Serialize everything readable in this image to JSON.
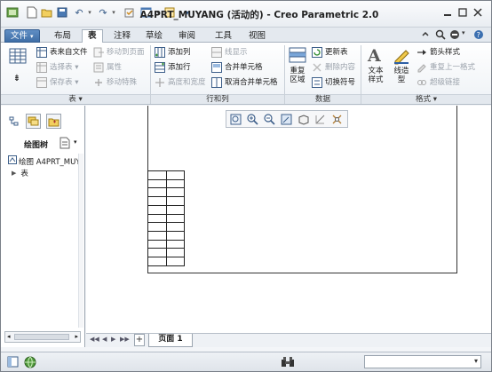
{
  "window": {
    "title": "A4PRT_MUYANG (活动的) - Creo Parametric 2.0"
  },
  "ribbon_tabs": [
    {
      "label": "文件",
      "arrow": "▾"
    },
    {
      "label": "布局"
    },
    {
      "label": "表"
    },
    {
      "label": "注释"
    },
    {
      "label": "草绘"
    },
    {
      "label": "审阅"
    },
    {
      "label": "工具"
    },
    {
      "label": "视图"
    }
  ],
  "ribbon": {
    "table_group": {
      "label": "表 ▾",
      "from_file": "表来自文件",
      "select_table": "选择表 ▾",
      "save_table": "保存表 ▾"
    },
    "move_group": {
      "move_to_page": "移动到页面",
      "properties": "属性",
      "move_special": "移动特殊"
    },
    "rows_cols_group": {
      "label": "行和列",
      "add_column": "添加列",
      "add_row": "添加行",
      "height_width": "高度和宽度",
      "line_display": "线显示",
      "merge_cells": "合并单元格",
      "unmerge_cells": "取消合并单元格"
    },
    "data_group": {
      "label": "数据",
      "repeat_region": "重复\n区域",
      "update_table": "更新表",
      "delete_content": "删除内容",
      "switch_symbols": "切换符号"
    },
    "format_group": {
      "label": "格式 ▾",
      "text_style": "文本\n样式",
      "line_style": "线造\n型",
      "arrow_style": "箭头样式",
      "repeat_format": "重复上一格式",
      "hyperlink": "超级链接"
    }
  },
  "left_panel": {
    "header": "绘图树",
    "tree": [
      {
        "label": "绘图 A4PRT_MUY"
      },
      {
        "label": "表"
      }
    ]
  },
  "page_tabs": {
    "add": "+",
    "current": "页面 1"
  },
  "colors": {
    "file_tab": "#4a79b3",
    "accent": "#3b5e8a"
  },
  "icons": [
    "new-icon",
    "open-icon",
    "save-icon",
    "undo-icon",
    "redo-icon",
    "regenerate-icon",
    "window-icon",
    "close-window-icon",
    "search-icon",
    "help-icon"
  ]
}
